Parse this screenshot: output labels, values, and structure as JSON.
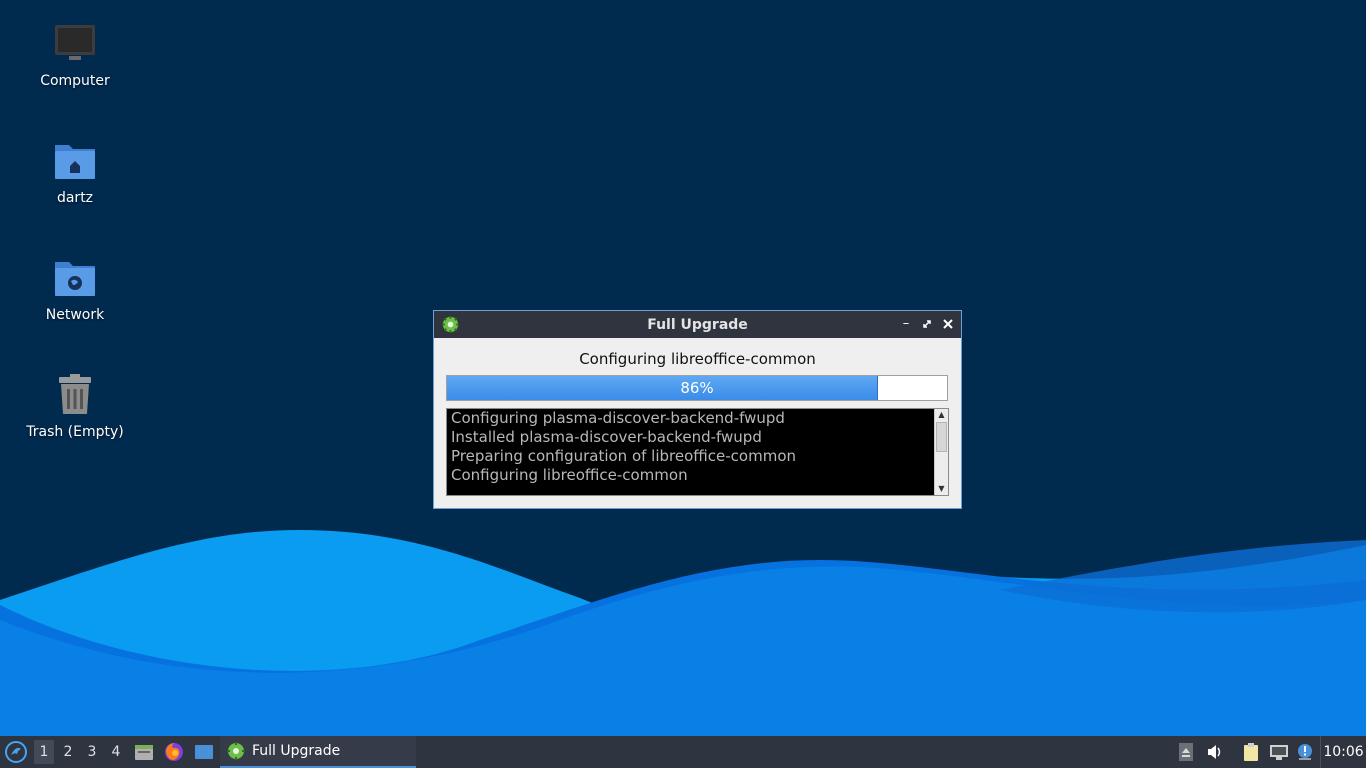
{
  "desktop": {
    "icons": [
      {
        "label": "Computer",
        "icon": "computer-icon"
      },
      {
        "label": "dartz",
        "icon": "home-folder-icon"
      },
      {
        "label": "Network",
        "icon": "network-folder-icon"
      },
      {
        "label": "Trash (Empty)",
        "icon": "trash-icon"
      }
    ]
  },
  "dialog": {
    "title": "Full Upgrade",
    "status": "Configuring libreoffice-common",
    "progress": {
      "value": 86,
      "text": "86%"
    },
    "log": [
      "Configuring plasma-discover-backend-fwupd",
      "Installed plasma-discover-backend-fwupd",
      "Preparing configuration of libreoffice-common",
      "Configuring libreoffice-common"
    ]
  },
  "taskbar": {
    "desktops": [
      "1",
      "2",
      "3",
      "4"
    ],
    "active_desktop": "1",
    "task_label": "Full Upgrade",
    "clock": "10:06"
  },
  "colors": {
    "background": "#012a4f",
    "accent": "#3a8ce8",
    "taskbar": "#2e3440",
    "titlebar": "#2f343f"
  }
}
